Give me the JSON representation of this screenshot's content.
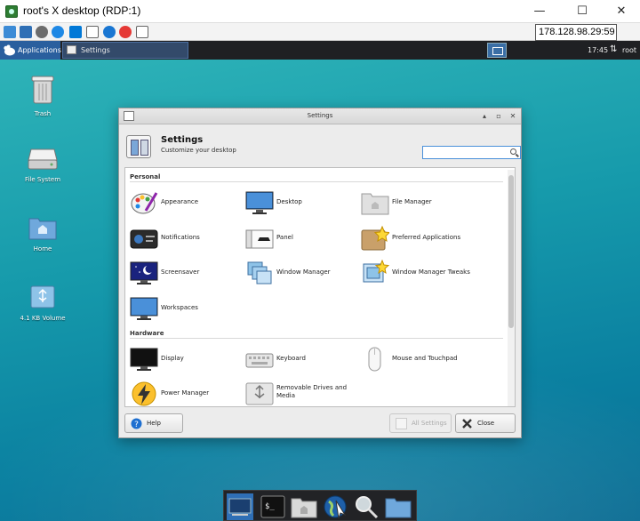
{
  "rdp": {
    "title": "root's X desktop (RDP:1)",
    "ip": "178.128.98.29:59",
    "minimize": "—",
    "maximize": "☐",
    "close": "✕"
  },
  "panel": {
    "applications": "Applications",
    "task_settings": "Settings",
    "clock": "17:45",
    "network_glyph": "⇅",
    "user": "root"
  },
  "desktop_icons": {
    "trash": "Trash",
    "filesystem": "File System",
    "home": "Home",
    "volume": "4.1 KB Volume"
  },
  "settings": {
    "window_title": "Settings",
    "title": "Settings",
    "subtitle": "Customize your desktop",
    "search_value": "",
    "sections": {
      "personal": "Personal",
      "hardware": "Hardware"
    },
    "personal_items": {
      "appearance": "Appearance",
      "desktop": "Desktop",
      "file_manager": "File Manager",
      "notifications": "Notifications",
      "panel": "Panel",
      "preferred_apps": "Preferred Applications",
      "screensaver": "Screensaver",
      "window_manager": "Window Manager",
      "wm_tweaks": "Window Manager Tweaks",
      "workspaces": "Workspaces"
    },
    "hardware_items": {
      "display": "Display",
      "keyboard": "Keyboard",
      "mouse": "Mouse and Touchpad",
      "power": "Power Manager",
      "removable": "Removable Drives and Media"
    },
    "buttons": {
      "help": "Help",
      "all_settings": "All Settings",
      "close": "Close"
    }
  },
  "colors": {
    "panel_bg": "#1f2023",
    "accent": "#2a5f9e",
    "desktop_teal": "#169aab"
  }
}
